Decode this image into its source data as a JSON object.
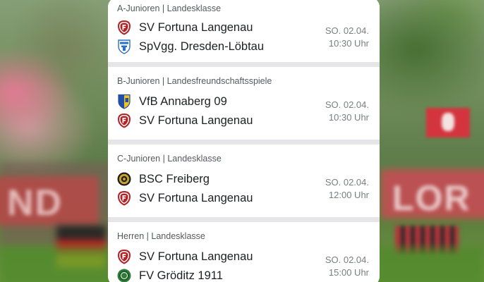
{
  "matches": [
    {
      "league": "A-Junioren | Landesklasse",
      "home": {
        "name": "SV Fortuna Langenau",
        "crest": "fortuna-crest-icon"
      },
      "away": {
        "name": "SpVgg. Dresden-Löbtau",
        "crest": "dresden-loebtau-crest-icon"
      },
      "date": "SO. 02.04.",
      "time": "10:30 Uhr"
    },
    {
      "league": "B-Junioren | Landesfreundschaftsspiele",
      "home": {
        "name": "VfB Annaberg 09",
        "crest": "annaberg-crest-icon"
      },
      "away": {
        "name": "SV Fortuna Langenau",
        "crest": "fortuna-crest-icon"
      },
      "date": "SO. 02.04.",
      "time": "10:30 Uhr"
    },
    {
      "league": "C-Junioren | Landesklasse",
      "home": {
        "name": "BSC Freiberg",
        "crest": "freiberg-crest-icon"
      },
      "away": {
        "name": "SV Fortuna Langenau",
        "crest": "fortuna-crest-icon"
      },
      "date": "SO. 02.04.",
      "time": "12:00 Uhr"
    },
    {
      "league": "Herren | Landesklasse",
      "home": {
        "name": "SV Fortuna Langenau",
        "crest": "fortuna-crest-icon"
      },
      "away": {
        "name": "FV Gröditz 1911",
        "crest": "groeditz-crest-icon"
      },
      "date": "SO. 02.04.",
      "time": "15:00 Uhr"
    }
  ],
  "colors": {
    "fortuna_red": "#b32025",
    "annaberg_yellow": "#f2c418",
    "annaberg_blue": "#1f4fa8",
    "freiberg_gold": "#c9a227",
    "groeditz_green": "#2e7d3a",
    "loebtau_blue": "#2a6fc4"
  }
}
